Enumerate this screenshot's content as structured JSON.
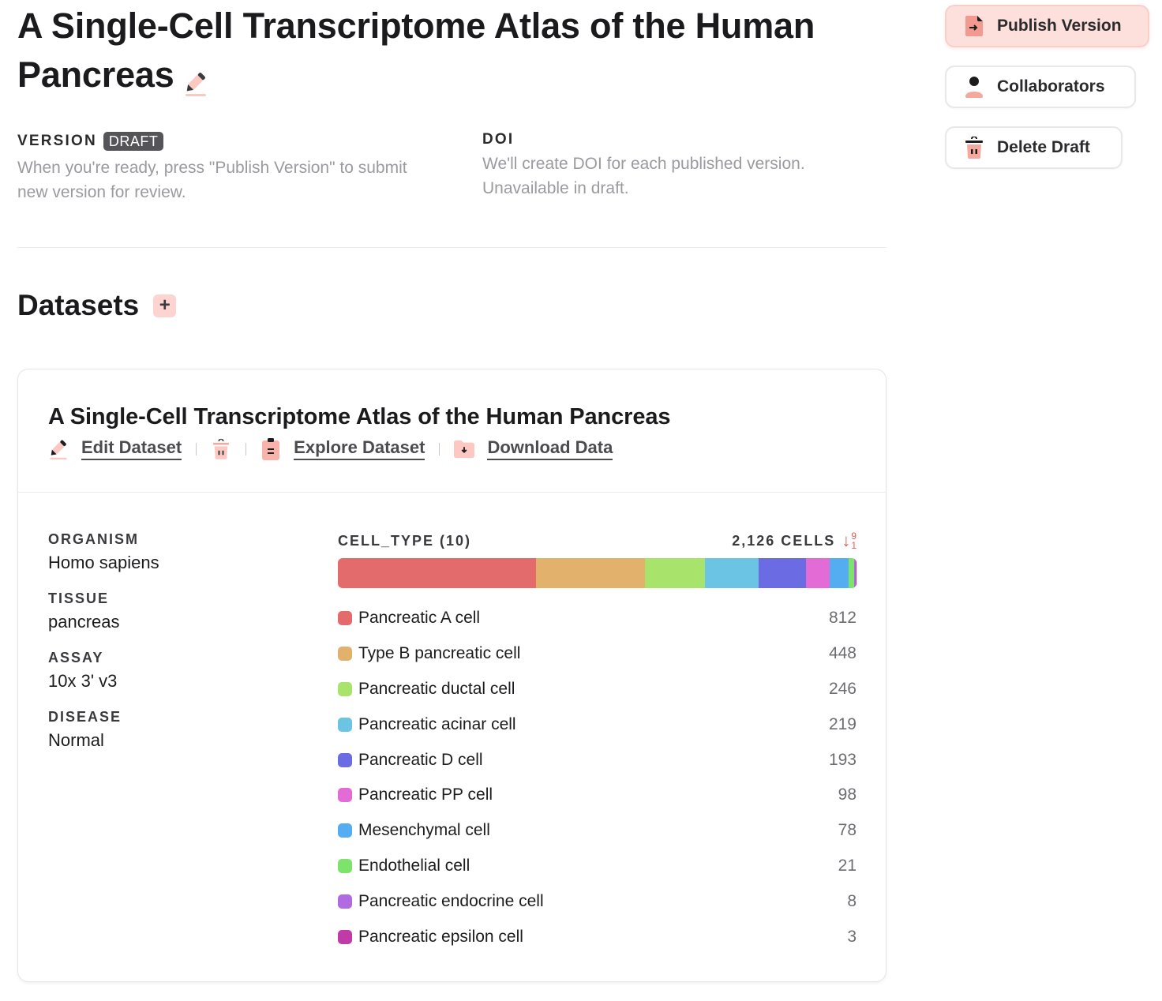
{
  "header": {
    "title": "A Single-Cell Transcriptome Atlas of the Human Pancreas",
    "edit_icon": "pencil-icon"
  },
  "actions": {
    "publish": {
      "label": "Publish Version",
      "icon": "file-export-icon"
    },
    "collaborators": {
      "label": "Collaborators",
      "icon": "user-icon"
    },
    "delete": {
      "label": "Delete Draft",
      "icon": "trash-icon"
    }
  },
  "version": {
    "label": "VERSION",
    "badge": "DRAFT",
    "description": "When you're ready, press \"Publish Version\" to submit new version for review."
  },
  "doi": {
    "label": "DOI",
    "description": "We'll create DOI for each published version. Unavailable in draft."
  },
  "datasets": {
    "heading": "Datasets",
    "add_label": "+"
  },
  "dataset_card": {
    "title": "A Single-Cell Transcriptome Atlas of the Human Pancreas",
    "actions": {
      "edit": "Edit Dataset",
      "explore": "Explore Dataset",
      "download": "Download Data"
    },
    "attributes": [
      {
        "label": "ORGANISM",
        "value": "Homo sapiens"
      },
      {
        "label": "TISSUE",
        "value": "pancreas"
      },
      {
        "label": "ASSAY",
        "value": "10x 3' v3"
      },
      {
        "label": "DISEASE",
        "value": "Normal"
      }
    ],
    "cell_type": {
      "label": "CELL_TYPE (10)",
      "total_label": "2,126 CELLS",
      "sort": {
        "icon": "sort-descending-icon",
        "top": "9",
        "bottom": "1"
      }
    }
  },
  "chart_data": {
    "type": "bar",
    "orientation": "horizontal-stacked",
    "title": "CELL_TYPE (10)",
    "total": 2126,
    "categories": [
      "Pancreatic A cell",
      "Type B pancreatic cell",
      "Pancreatic ductal cell",
      "Pancreatic acinar cell",
      "Pancreatic D cell",
      "Pancreatic PP cell",
      "Mesenchymal cell",
      "Endothelial cell",
      "Pancreatic endocrine cell",
      "Pancreatic epsilon cell"
    ],
    "values": [
      812,
      448,
      246,
      219,
      193,
      98,
      78,
      21,
      8,
      3
    ],
    "colors": [
      "#e36b6b",
      "#e2b26d",
      "#a8e36b",
      "#6bc4e3",
      "#6b6be3",
      "#e36bd6",
      "#55adf1",
      "#7ee36b",
      "#b06be3",
      "#c03aa8"
    ]
  }
}
